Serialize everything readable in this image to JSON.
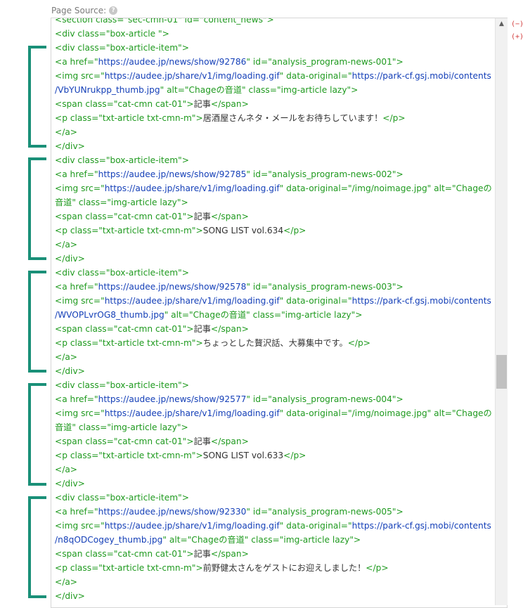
{
  "header": {
    "label": "Page Source:",
    "help_icon": "?"
  },
  "controls": {
    "collapse": "(−)",
    "expand": "(+)"
  },
  "scrollbar": {
    "up_arrow": "▲"
  },
  "colors": {
    "tag": "#1f9a1f",
    "string": "#1540b8",
    "text": "#333333",
    "bracket": "#1a9078"
  },
  "lines": [
    [
      [
        "t",
        "<section class=\"sec-cmn-01\" id=\"content_news\">"
      ]
    ],
    [
      [
        "t",
        "<div class=\"box-article \">"
      ]
    ],
    [
      [
        "t",
        "<div class=\"box-article-item\">"
      ]
    ],
    [
      [
        "t",
        "<a href=\""
      ],
      [
        "s",
        "https://audee.jp/news/show/92786"
      ],
      [
        "t",
        "\" id=\"analysis_program-news-001\">"
      ]
    ],
    [
      [
        "t",
        "<img src=\""
      ],
      [
        "s",
        "https://audee.jp/share/v1/img/loading.gif"
      ],
      [
        "t",
        "\" data-original=\""
      ],
      [
        "s",
        "https://park-cf.gsj.mobi/contents"
      ]
    ],
    [
      [
        "s",
        "/VbYUNrukpp_thumb.jpg"
      ],
      [
        "t",
        "\" alt=\"Chageの音道\" class=\"img-article lazy\">"
      ]
    ],
    [
      [
        "t",
        "<span class=\"cat-cmn cat-01\">"
      ],
      [
        "x",
        "記事"
      ],
      [
        "t",
        "</span>"
      ]
    ],
    [
      [
        "t",
        "<p class=\"txt-article txt-cmn-m\">"
      ],
      [
        "x",
        "居酒屋さんネタ・メールをお待ちしています！"
      ],
      [
        "t",
        "</p>"
      ]
    ],
    [
      [
        "t",
        "</a>"
      ]
    ],
    [
      [
        "t",
        "</div>"
      ]
    ],
    [
      [
        "t",
        "<div class=\"box-article-item\">"
      ]
    ],
    [
      [
        "t",
        "<a href=\""
      ],
      [
        "s",
        "https://audee.jp/news/show/92785"
      ],
      [
        "t",
        "\" id=\"analysis_program-news-002\">"
      ]
    ],
    [
      [
        "t",
        "<img src=\""
      ],
      [
        "s",
        "https://audee.jp/share/v1/img/loading.gif"
      ],
      [
        "t",
        "\" data-original=\"/img/noimage.jpg\" alt=\"Chageの"
      ]
    ],
    [
      [
        "t",
        "音道\" class=\"img-article lazy\">"
      ]
    ],
    [
      [
        "t",
        "<span class=\"cat-cmn cat-01\">"
      ],
      [
        "x",
        "記事"
      ],
      [
        "t",
        "</span>"
      ]
    ],
    [
      [
        "t",
        "<p class=\"txt-article txt-cmn-m\">"
      ],
      [
        "x",
        "SONG LIST vol.634"
      ],
      [
        "t",
        "</p>"
      ]
    ],
    [
      [
        "t",
        "</a>"
      ]
    ],
    [
      [
        "t",
        "</div>"
      ]
    ],
    [
      [
        "t",
        "<div class=\"box-article-item\">"
      ]
    ],
    [
      [
        "t",
        "<a href=\""
      ],
      [
        "s",
        "https://audee.jp/news/show/92578"
      ],
      [
        "t",
        "\" id=\"analysis_program-news-003\">"
      ]
    ],
    [
      [
        "t",
        "<img src=\""
      ],
      [
        "s",
        "https://audee.jp/share/v1/img/loading.gif"
      ],
      [
        "t",
        "\" data-original=\""
      ],
      [
        "s",
        "https://park-cf.gsj.mobi/contents"
      ]
    ],
    [
      [
        "s",
        "/WVOPLvrOG8_thumb.jpg"
      ],
      [
        "t",
        "\" alt=\"Chageの音道\" class=\"img-article lazy\">"
      ]
    ],
    [
      [
        "t",
        "<span class=\"cat-cmn cat-01\">"
      ],
      [
        "x",
        "記事"
      ],
      [
        "t",
        "</span>"
      ]
    ],
    [
      [
        "t",
        "<p class=\"txt-article txt-cmn-m\">"
      ],
      [
        "x",
        "ちょっとした贅沢話、大募集中です。"
      ],
      [
        "t",
        "</p>"
      ]
    ],
    [
      [
        "t",
        "</a>"
      ]
    ],
    [
      [
        "t",
        "</div>"
      ]
    ],
    [
      [
        "t",
        "<div class=\"box-article-item\">"
      ]
    ],
    [
      [
        "t",
        "<a href=\""
      ],
      [
        "s",
        "https://audee.jp/news/show/92577"
      ],
      [
        "t",
        "\" id=\"analysis_program-news-004\">"
      ]
    ],
    [
      [
        "t",
        "<img src=\""
      ],
      [
        "s",
        "https://audee.jp/share/v1/img/loading.gif"
      ],
      [
        "t",
        "\" data-original=\"/img/noimage.jpg\" alt=\"Chageの"
      ]
    ],
    [
      [
        "t",
        "音道\" class=\"img-article lazy\">"
      ]
    ],
    [
      [
        "t",
        "<span class=\"cat-cmn cat-01\">"
      ],
      [
        "x",
        "記事"
      ],
      [
        "t",
        "</span>"
      ]
    ],
    [
      [
        "t",
        "<p class=\"txt-article txt-cmn-m\">"
      ],
      [
        "x",
        "SONG LIST vol.633"
      ],
      [
        "t",
        "</p>"
      ]
    ],
    [
      [
        "t",
        "</a>"
      ]
    ],
    [
      [
        "t",
        "</div>"
      ]
    ],
    [
      [
        "t",
        "<div class=\"box-article-item\">"
      ]
    ],
    [
      [
        "t",
        "<a href=\""
      ],
      [
        "s",
        "https://audee.jp/news/show/92330"
      ],
      [
        "t",
        "\" id=\"analysis_program-news-005\">"
      ]
    ],
    [
      [
        "t",
        "<img src=\""
      ],
      [
        "s",
        "https://audee.jp/share/v1/img/loading.gif"
      ],
      [
        "t",
        "\" data-original=\""
      ],
      [
        "s",
        "https://park-cf.gsj.mobi/contents"
      ]
    ],
    [
      [
        "s",
        "/n8qODCogey_thumb.jpg"
      ],
      [
        "t",
        "\" alt=\"Chageの音道\" class=\"img-article lazy\">"
      ]
    ],
    [
      [
        "t",
        "<span class=\"cat-cmn cat-01\">"
      ],
      [
        "x",
        "記事"
      ],
      [
        "t",
        "</span>"
      ]
    ],
    [
      [
        "t",
        "<p class=\"txt-article txt-cmn-m\">"
      ],
      [
        "x",
        "前野健太さんをゲストにお迎えしました！"
      ],
      [
        "t",
        "</p>"
      ]
    ],
    [
      [
        "t",
        "</a>"
      ]
    ],
    [
      [
        "t",
        "</div>"
      ]
    ]
  ]
}
